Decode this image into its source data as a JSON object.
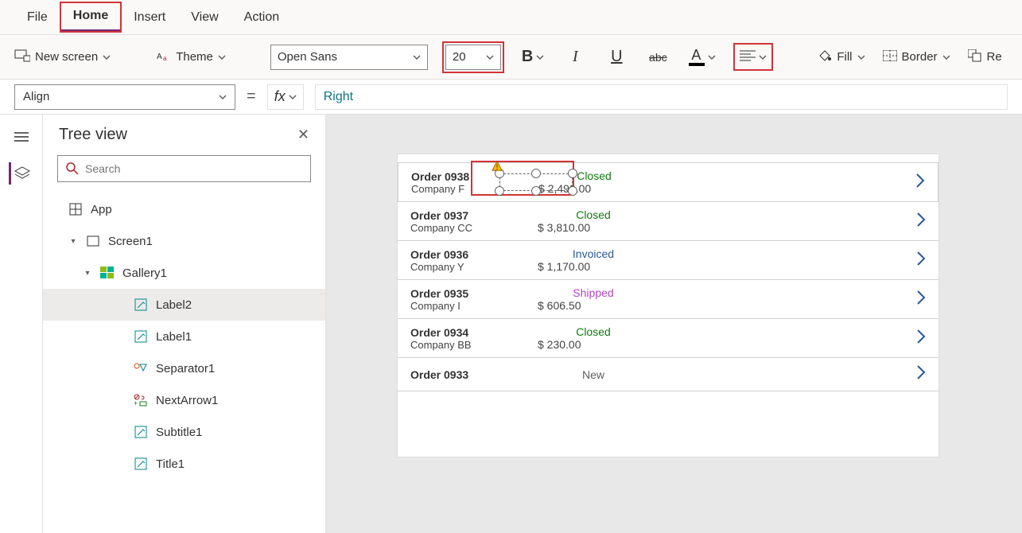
{
  "menu": {
    "file": "File",
    "home": "Home",
    "insert": "Insert",
    "view": "View",
    "action": "Action"
  },
  "ribbon": {
    "new_screen": "New screen",
    "theme": "Theme",
    "font_name": "Open Sans",
    "font_size": "20",
    "fill": "Fill",
    "border": "Border",
    "reorder": "Re"
  },
  "formula": {
    "property": "Align",
    "fx": "fx",
    "value": "Right"
  },
  "tree": {
    "header": "Tree view",
    "search_placeholder": "Search",
    "app": "App",
    "screen1": "Screen1",
    "gallery1": "Gallery1",
    "label2": "Label2",
    "label1": "Label1",
    "separator1": "Separator1",
    "nextarrow1": "NextArrow1",
    "subtitle1": "Subtitle1",
    "title1": "Title1"
  },
  "gallery": [
    {
      "order": "Order 0938",
      "company": "Company F",
      "status": "Closed",
      "price": "$ 2,490.00"
    },
    {
      "order": "Order 0937",
      "company": "Company CC",
      "status": "Closed",
      "price": "$ 3,810.00"
    },
    {
      "order": "Order 0936",
      "company": "Company Y",
      "status": "Invoiced",
      "price": "$ 1,170.00"
    },
    {
      "order": "Order 0935",
      "company": "Company I",
      "status": "Shipped",
      "price": "$ 606.50"
    },
    {
      "order": "Order 0934",
      "company": "Company BB",
      "status": "Closed",
      "price": "$ 230.00"
    },
    {
      "order": "Order 0933",
      "company": "",
      "status": "New",
      "price": ""
    }
  ],
  "colors": {
    "accent": "#742774",
    "highlight": "#d13438"
  }
}
